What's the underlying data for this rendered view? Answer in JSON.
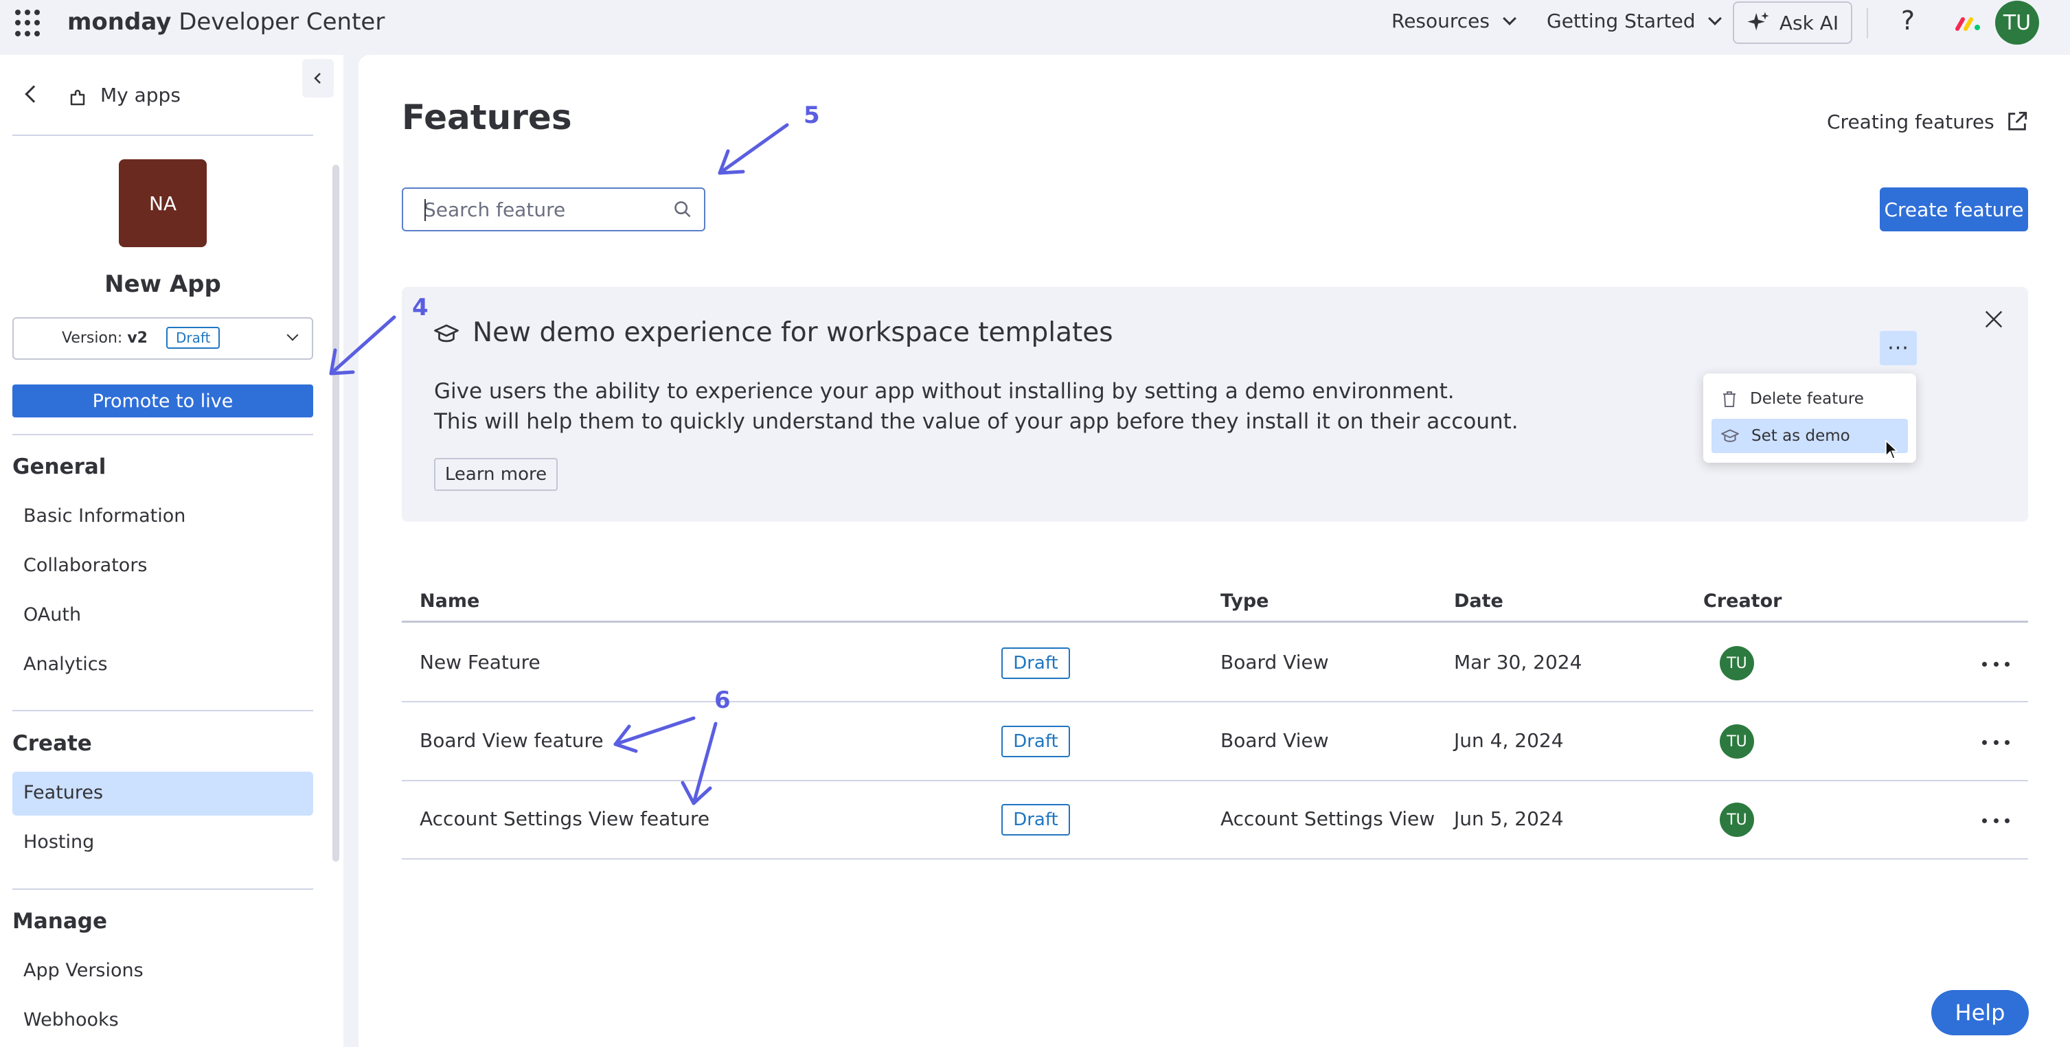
{
  "topbar": {
    "brand_bold": "monday",
    "brand_rest": " Developer Center",
    "resources": "Resources",
    "getting_started": "Getting Started",
    "ask_ai": "Ask AI",
    "help_glyph": "?",
    "avatar": "TU"
  },
  "sidebar": {
    "back_label": "My apps",
    "app_initials": "NA",
    "app_name": "New App",
    "version_prefix": "Version:",
    "version_value": "v2",
    "version_status": "Draft",
    "promote_label": "Promote to live",
    "sections": {
      "general": "General",
      "create": "Create",
      "manage": "Manage"
    },
    "items": {
      "basic_information": "Basic Information",
      "collaborators": "Collaborators",
      "oauth": "OAuth",
      "analytics": "Analytics",
      "features": "Features",
      "hosting": "Hosting",
      "app_versions": "App Versions",
      "webhooks": "Webhooks"
    }
  },
  "main": {
    "title": "Features",
    "creating_link": "Creating features",
    "search_placeholder": "Search feature",
    "create_button": "Create feature"
  },
  "banner": {
    "title": "New demo experience for workspace templates",
    "line1": "Give users the ability to experience your app without installing by setting a demo environment.",
    "line2": "This will help them to quickly understand the value of your app before they install it on their account.",
    "learn_more": "Learn more",
    "menu_glyph": "···",
    "dropdown": {
      "delete": "Delete feature",
      "set_demo": "Set as demo"
    }
  },
  "table": {
    "headers": {
      "name": "Name",
      "type": "Type",
      "date": "Date",
      "creator": "Creator"
    },
    "rows": [
      {
        "name": "New Feature",
        "status": "Draft",
        "type": "Board View",
        "date": "Mar 30, 2024",
        "creator": "TU"
      },
      {
        "name": "Board View feature",
        "status": "Draft",
        "type": "Board View",
        "date": "Jun 4, 2024",
        "creator": "TU"
      },
      {
        "name": "Account Settings View feature",
        "status": "Draft",
        "type": "Account Settings View",
        "date": "Jun 5, 2024",
        "creator": "TU"
      }
    ]
  },
  "annotations": {
    "a4": "4",
    "a5": "5",
    "a6": "6"
  },
  "help_button": "Help",
  "colors": {
    "accent": "#2f6fd8",
    "selected": "#cce0ff",
    "avatar_green": "#2c7a3f",
    "app_tile": "#6a2a1f",
    "annotation": "#5a5ee0"
  }
}
